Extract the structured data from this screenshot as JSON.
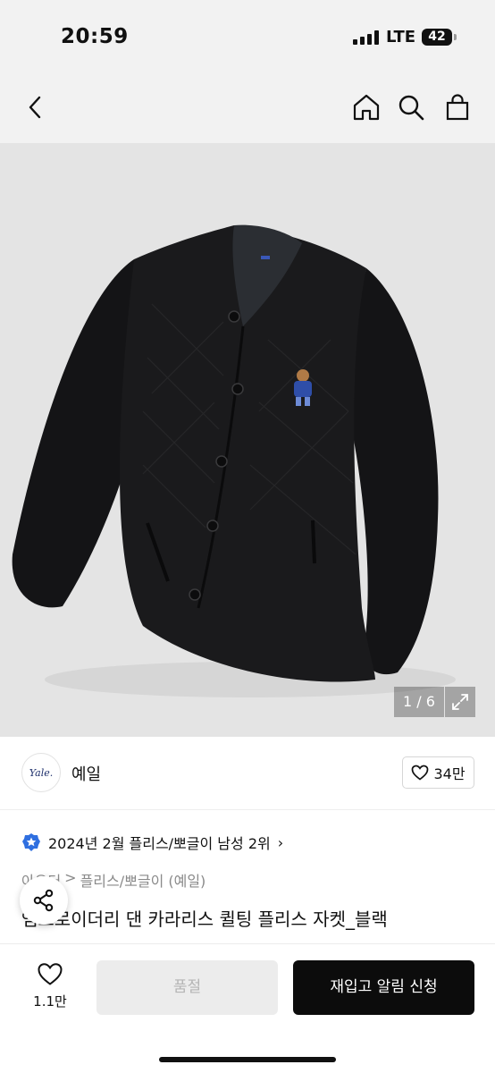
{
  "status_bar": {
    "time": "20:59",
    "network": "LTE",
    "battery": "42"
  },
  "nav": {
    "icons": [
      "back-icon",
      "home-icon",
      "search-icon",
      "shopping-bag-icon"
    ]
  },
  "image": {
    "counter": "1 / 6",
    "expand_icon": "expand-icon"
  },
  "brand": {
    "logo_text": "Yale.",
    "name": "예일",
    "likes": "34만"
  },
  "ranking": {
    "text": "2024년 2월 플리스/뽀글이 남성 2위",
    "chevron": "›",
    "badge_color": "#2f6fe0"
  },
  "breadcrumb": {
    "category": "아우터",
    "separator": ">",
    "subcategory": "플리스/뽀글이 (예일)"
  },
  "product": {
    "title": "엠브로이더리 댄 카라리스 퀼팅 플리스 자켓_블랙"
  },
  "bottom": {
    "wish_count": "1.1만",
    "soldout_label": "품절",
    "restock_label": "재입고 알림 신청"
  }
}
